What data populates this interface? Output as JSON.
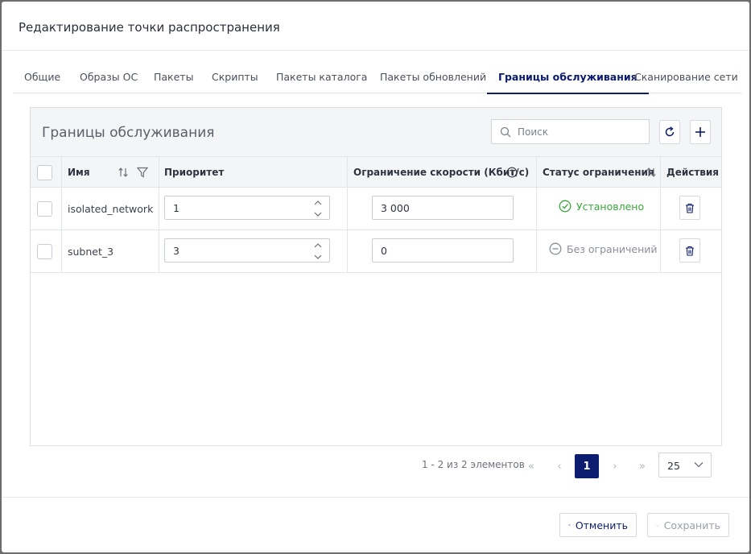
{
  "dialog": {
    "title": "Редактирование точки распространения"
  },
  "tabs": [
    {
      "label": "Общие"
    },
    {
      "label": "Образы ОС"
    },
    {
      "label": "Пакеты"
    },
    {
      "label": "Скрипты"
    },
    {
      "label": "Пакеты каталога"
    },
    {
      "label": "Пакеты обновлений"
    },
    {
      "label": "Границы обслуживания"
    },
    {
      "label": "Сканирование сети"
    }
  ],
  "active_tab": "Границы обслуживания",
  "panel": {
    "title": "Границы обслуживания",
    "search_placeholder": "Поиск"
  },
  "table": {
    "columns": {
      "name": "Имя",
      "priority": "Приоритет",
      "speed": "Ограничение скорости (Кбит/с)",
      "status": "Статус ограничения",
      "actions": "Действия"
    },
    "rows": [
      {
        "name": "isolated_network",
        "priority": "1",
        "speed": "3 000",
        "status": "Установлено"
      },
      {
        "name": "subnet_3",
        "priority": "3",
        "speed": "0",
        "status": "Без ограничений"
      }
    ]
  },
  "pagination": {
    "info": "1 - 2 из 2 элементов",
    "current_page": "1",
    "page_size": "25"
  },
  "footer": {
    "cancel_label": "Отменить",
    "save_label": "Сохранить"
  },
  "colors": {
    "accent": "#0c1c6e",
    "status_set": "#3aa63a",
    "status_none": "#8a8f99"
  },
  "icons": {
    "search": "search-icon",
    "refresh": "refresh-icon",
    "add": "plus-icon",
    "sort": "sort-icon",
    "filter": "filter-icon",
    "info": "info-icon",
    "status_set": "check-circle-icon",
    "status_none": "minus-circle-icon",
    "delete": "trash-icon",
    "cancel": "close-icon",
    "save": "check-icon"
  }
}
